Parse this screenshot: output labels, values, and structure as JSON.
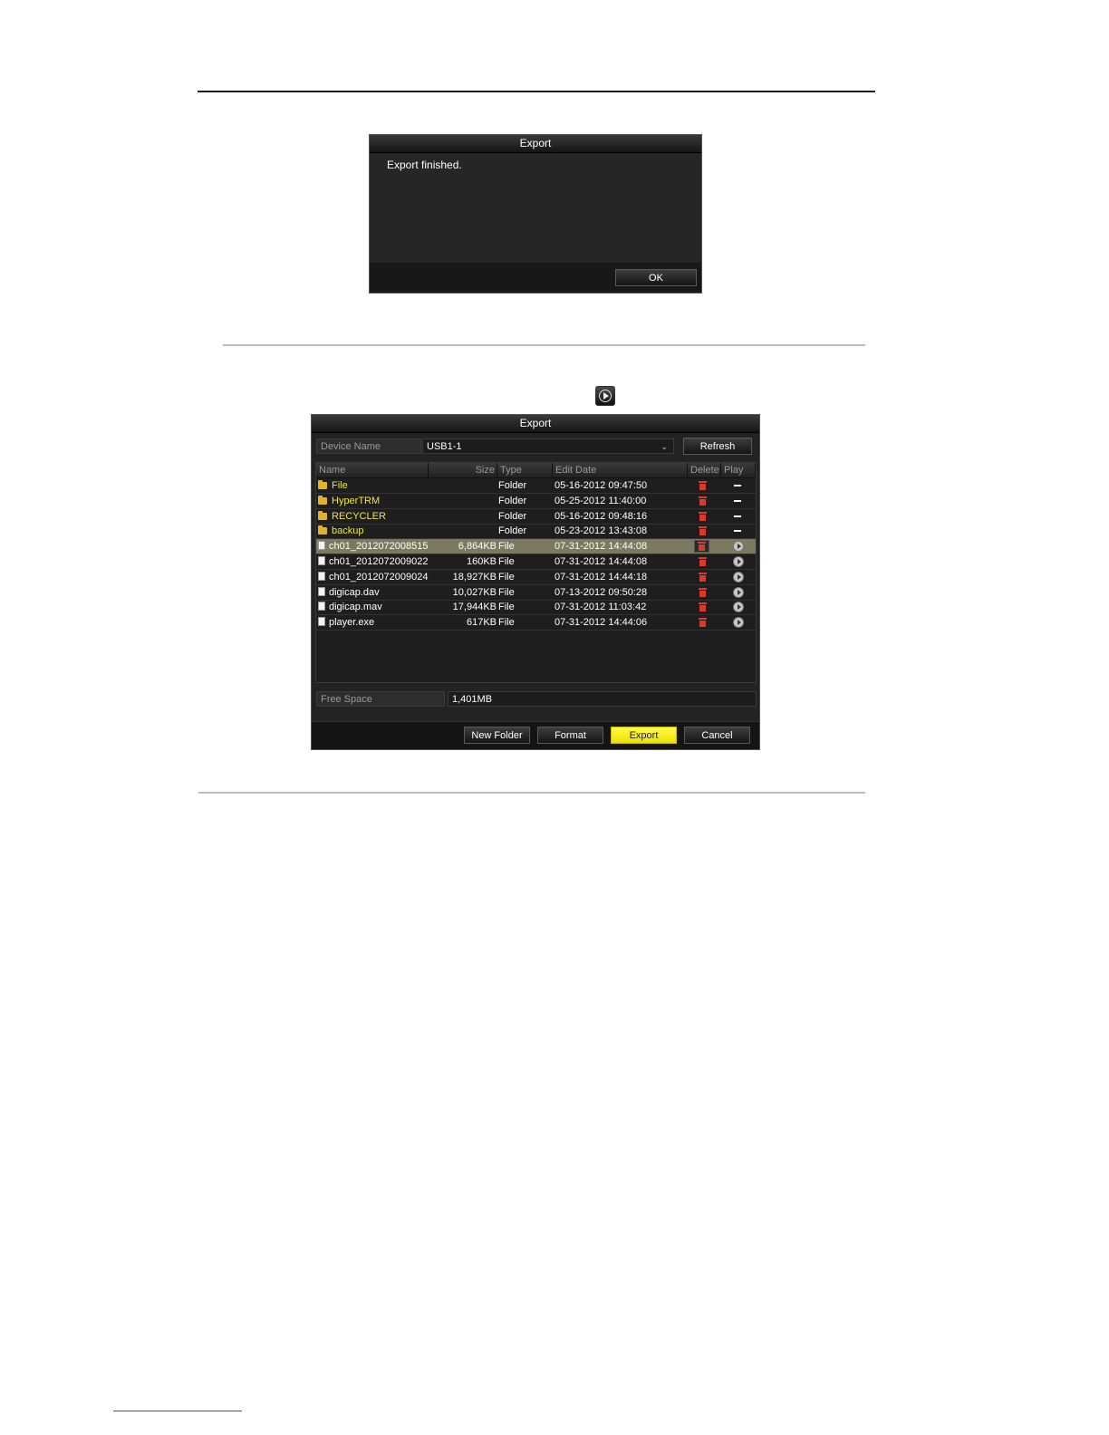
{
  "dialog_finished": {
    "title": "Export",
    "message": "Export finished.",
    "ok_label": "OK"
  },
  "dialog_export": {
    "title": "Export",
    "device_name_label": "Device Name",
    "device_name_value": "USB1-1",
    "refresh_label": "Refresh",
    "columns": {
      "name": "Name",
      "size": "Size",
      "type": "Type",
      "edit_date": "Edit Date",
      "delete": "Delete",
      "play": "Play"
    },
    "rows": [
      {
        "name": "File",
        "size": "",
        "type": "Folder",
        "date": "05-16-2012 09:47:50",
        "kind": "folder"
      },
      {
        "name": "HyperTRM",
        "size": "",
        "type": "Folder",
        "date": "05-25-2012 11:40:00",
        "kind": "folder"
      },
      {
        "name": "RECYCLER",
        "size": "",
        "type": "Folder",
        "date": "05-16-2012 09:48:16",
        "kind": "folder"
      },
      {
        "name": "backup",
        "size": "",
        "type": "Folder",
        "date": "05-23-2012 13:43:08",
        "kind": "folder"
      },
      {
        "name": "ch01_2012072008515",
        "size": "6,864KB",
        "type": "File",
        "date": "07-31-2012 14:44:08",
        "kind": "file",
        "selected": true
      },
      {
        "name": "ch01_2012072009022",
        "size": "160KB",
        "type": "File",
        "date": "07-31-2012 14:44:08",
        "kind": "file"
      },
      {
        "name": "ch01_2012072009024",
        "size": "18,927KB",
        "type": "File",
        "date": "07-31-2012 14:44:18",
        "kind": "file"
      },
      {
        "name": "digicap.dav",
        "size": "10,027KB",
        "type": "File",
        "date": "07-13-2012 09:50:28",
        "kind": "file"
      },
      {
        "name": "digicap.mav",
        "size": "17,944KB",
        "type": "File",
        "date": "07-31-2012 11:03:42",
        "kind": "file"
      },
      {
        "name": "player.exe",
        "size": "617KB",
        "type": "File",
        "date": "07-31-2012 14:44:06",
        "kind": "file"
      }
    ],
    "free_space_label": "Free Space",
    "free_space_value": "1,401MB",
    "new_folder_label": "New Folder",
    "format_label": "Format",
    "export_label": "Export",
    "cancel_label": "Cancel"
  },
  "colors": {
    "folder_text": "#f0e63a",
    "selected_row": "#7b7a61",
    "primary_button": "#fff94a",
    "delete_icon": "#d73a2e"
  }
}
